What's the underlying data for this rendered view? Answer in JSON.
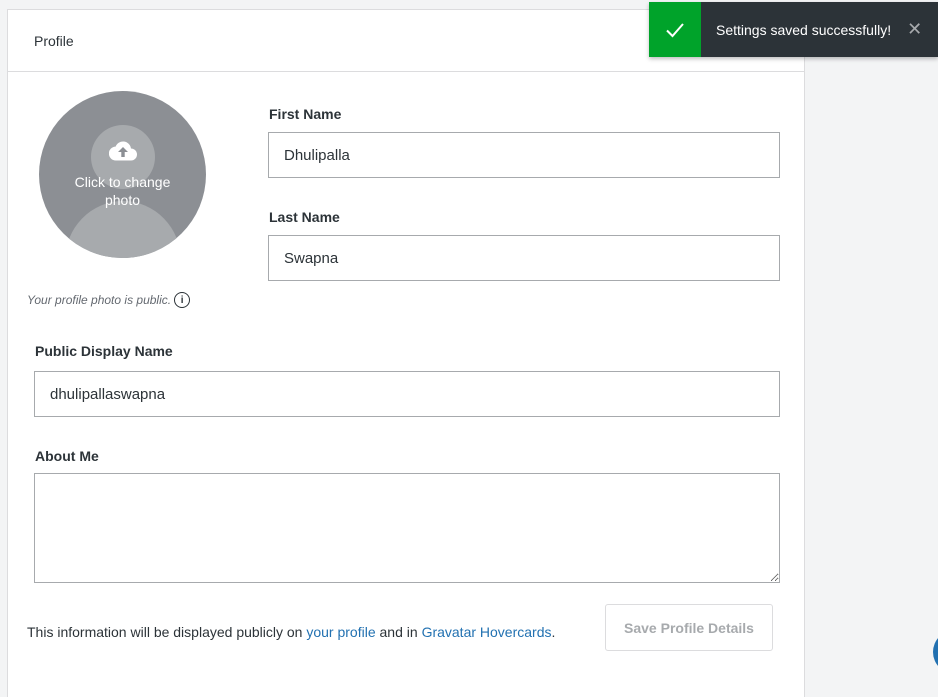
{
  "header": {
    "title": "Profile"
  },
  "avatar": {
    "overlay_text": "Click to change photo"
  },
  "photo_note": {
    "text": "Your profile photo is public.",
    "info_icon": "i"
  },
  "first_name": {
    "label": "First Name",
    "value": "Dhulipalla"
  },
  "last_name": {
    "label": "Last Name",
    "value": "Swapna"
  },
  "display_name": {
    "label": "Public Display Name",
    "value": "dhulipallaswapna"
  },
  "about_me": {
    "label": "About Me",
    "value": ""
  },
  "footer": {
    "text_before": "This information will be displayed publicly on ",
    "link_profile": "your profile",
    "text_middle": " and in ",
    "link_gravatar": "Gravatar Hovercards",
    "text_after": "."
  },
  "save_button": {
    "label": "Save Profile Details"
  },
  "toast": {
    "message": "Settings saved successfully!",
    "close_glyph": "✕"
  },
  "colors": {
    "accent": "#2271b1",
    "success": "#00a32a",
    "toast_bg": "#2c3338"
  }
}
